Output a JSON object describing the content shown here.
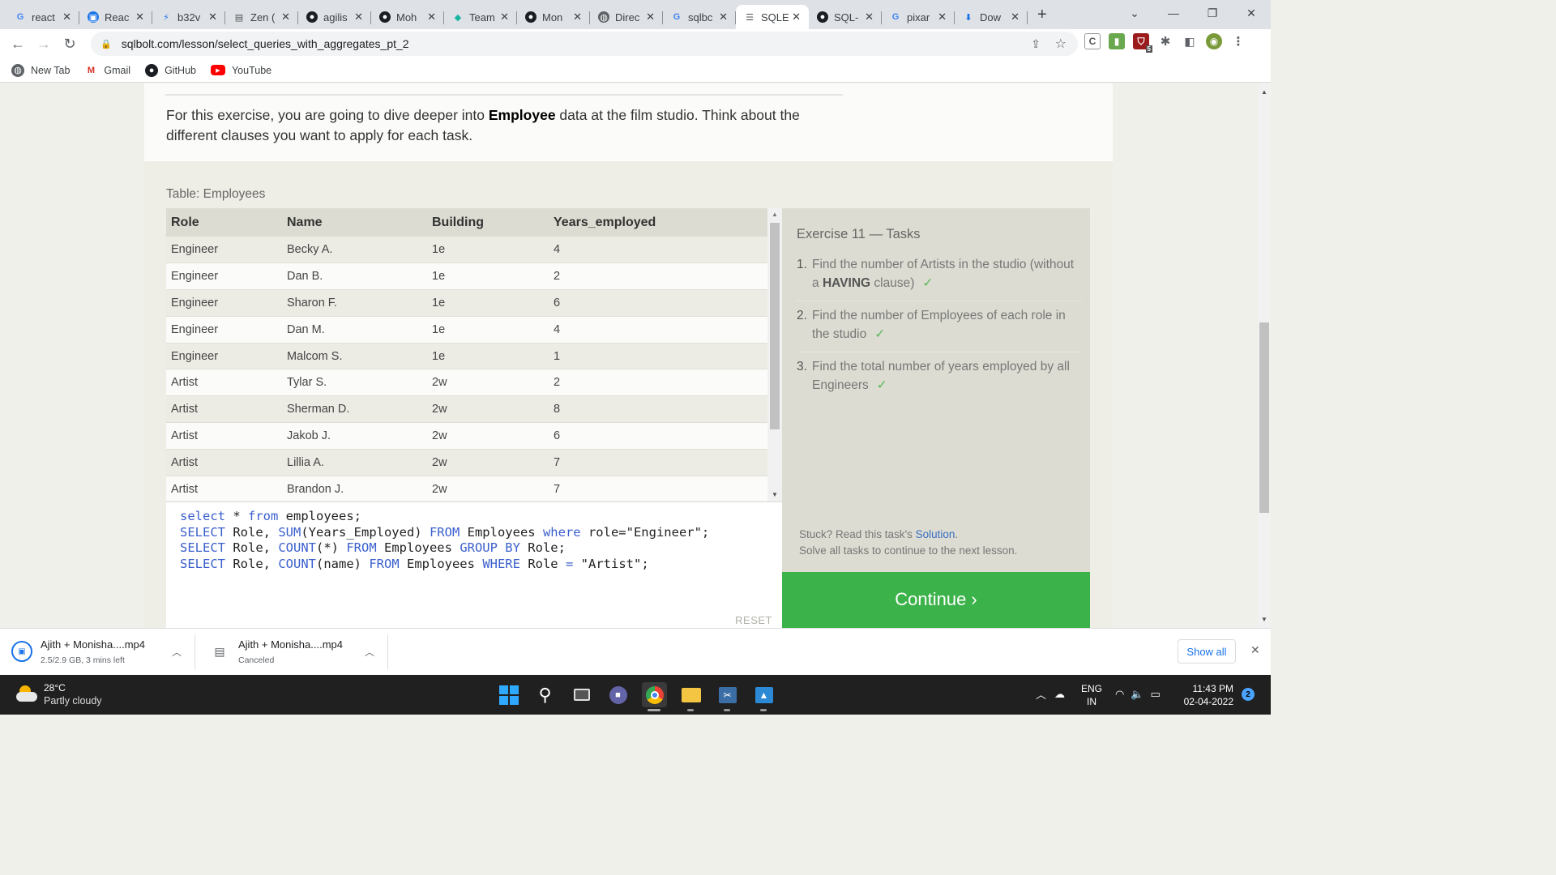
{
  "browser": {
    "tabs": [
      {
        "favicon": "google-icon",
        "label": "react"
      },
      {
        "favicon": "react-doc-icon",
        "label": "Reac"
      },
      {
        "favicon": "bolt-icon",
        "label": "b32v"
      },
      {
        "favicon": "zen-icon",
        "label": "Zen ("
      },
      {
        "favicon": "github-icon",
        "label": "agilis"
      },
      {
        "favicon": "github-icon",
        "label": "Moh"
      },
      {
        "favicon": "teams-diamond-icon",
        "label": "Team"
      },
      {
        "favicon": "github-icon",
        "label": "Mon"
      },
      {
        "favicon": "globe-icon",
        "label": "Direc"
      },
      {
        "favicon": "google-icon",
        "label": "sqlbc"
      },
      {
        "favicon": "database-icon",
        "label": "SQLE",
        "active": true
      },
      {
        "favicon": "github-icon",
        "label": "SQL-"
      },
      {
        "favicon": "google-icon",
        "label": "pixar"
      },
      {
        "favicon": "download-icon",
        "label": "Dow"
      }
    ],
    "url": "sqlbolt.com/lesson/select_queries_with_aggregates_pt_2",
    "bookmarks": [
      {
        "icon": "globe-icon",
        "label": "New Tab"
      },
      {
        "icon": "gmail-icon",
        "label": "Gmail"
      },
      {
        "icon": "github-icon",
        "label": "GitHub"
      },
      {
        "icon": "youtube-icon",
        "label": "YouTube"
      }
    ],
    "extension_badge": "5"
  },
  "lesson": {
    "intro_before": "For this exercise, you are going to dive deeper into ",
    "intro_bold": "Employee",
    "intro_after": " data at the film studio. Think about the different clauses you want to apply for each task.",
    "table_caption": "Table: Employees",
    "columns": [
      "Role",
      "Name",
      "Building",
      "Years_employed"
    ],
    "rows": [
      [
        "Engineer",
        "Becky A.",
        "1e",
        "4"
      ],
      [
        "Engineer",
        "Dan B.",
        "1e",
        "2"
      ],
      [
        "Engineer",
        "Sharon F.",
        "1e",
        "6"
      ],
      [
        "Engineer",
        "Dan M.",
        "1e",
        "4"
      ],
      [
        "Engineer",
        "Malcom S.",
        "1e",
        "1"
      ],
      [
        "Artist",
        "Tylar S.",
        "2w",
        "2"
      ],
      [
        "Artist",
        "Sherman D.",
        "2w",
        "8"
      ],
      [
        "Artist",
        "Jakob J.",
        "2w",
        "6"
      ],
      [
        "Artist",
        "Lillia A.",
        "2w",
        "7"
      ],
      [
        "Artist",
        "Brandon J.",
        "2w",
        "7"
      ]
    ],
    "code_lines": [
      [
        {
          "t": "select",
          "k": 1
        },
        {
          "t": " * ",
          "k": 0
        },
        {
          "t": "from",
          "k": 1
        },
        {
          "t": " employees;",
          "k": 0
        }
      ],
      [
        {
          "t": "SELECT",
          "k": 1
        },
        {
          "t": " Role, ",
          "k": 0
        },
        {
          "t": "SUM",
          "k": 1
        },
        {
          "t": "(Years_Employed) ",
          "k": 0
        },
        {
          "t": "FROM",
          "k": 1
        },
        {
          "t": " Employees ",
          "k": 0
        },
        {
          "t": "where",
          "k": 1
        },
        {
          "t": " role=\"Engineer\";",
          "k": 0
        }
      ],
      [
        {
          "t": "SELECT",
          "k": 1
        },
        {
          "t": " Role, ",
          "k": 0
        },
        {
          "t": "COUNT",
          "k": 1
        },
        {
          "t": "(*) ",
          "k": 0
        },
        {
          "t": "FROM",
          "k": 1
        },
        {
          "t": " Employees ",
          "k": 0
        },
        {
          "t": "GROUP BY",
          "k": 1
        },
        {
          "t": " Role;",
          "k": 0
        }
      ],
      [
        {
          "t": "SELECT",
          "k": 1
        },
        {
          "t": " Role, ",
          "k": 0
        },
        {
          "t": "COUNT",
          "k": 1
        },
        {
          "t": "(name) ",
          "k": 0
        },
        {
          "t": "FROM",
          "k": 1
        },
        {
          "t": " Employees ",
          "k": 0
        },
        {
          "t": "WHERE",
          "k": 1
        },
        {
          "t": " Role ",
          "k": 0
        },
        {
          "t": "=",
          "k": 1
        },
        {
          "t": " \"Artist\";",
          "k": 0
        }
      ]
    ],
    "reset_label": "RESET",
    "tasks_title": "Exercise 11 — Tasks",
    "tasks": [
      {
        "num": "1.",
        "before": "Find the number of Artists in the studio (without a ",
        "bold": "HAVING",
        "after": " clause)",
        "check": "✓"
      },
      {
        "num": "2.",
        "before": "Find the number of Employees of each role in the studio",
        "bold": "",
        "after": "",
        "check": "✓"
      },
      {
        "num": "3.",
        "before": "Find the total number of years employed by all Engineers",
        "bold": "",
        "after": "",
        "check": "✓"
      }
    ],
    "stuck_prefix": "Stuck? Read this task's ",
    "stuck_link": "Solution",
    "stuck_suffix": ".",
    "solve_note": "Solve all tasks to continue to the next lesson.",
    "continue_label": "Continue ›"
  },
  "downloads": [
    {
      "name": "Ajith + Monisha....mp4",
      "status": "2.5/2.9 GB, 3 mins left"
    },
    {
      "name": "Ajith + Monisha....mp4",
      "status": "Canceled"
    }
  ],
  "show_all_label": "Show all",
  "taskbar": {
    "temperature": "28°C",
    "weather": "Partly cloudy",
    "lang_1": "ENG",
    "lang_2": "IN",
    "time": "11:43 PM",
    "date": "02-04-2022",
    "notifications": "2"
  }
}
